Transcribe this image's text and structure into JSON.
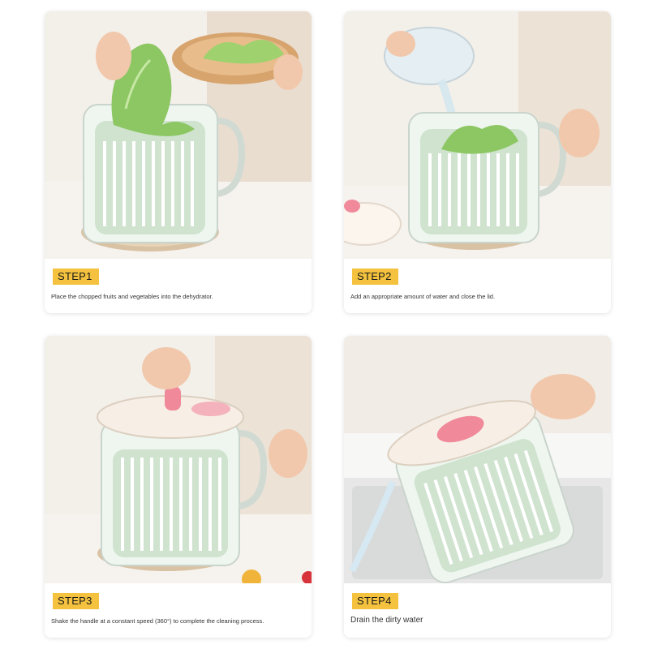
{
  "steps": [
    {
      "label": "STEP1",
      "text": "Place the chopped fruits and vegetables into the dehydrator."
    },
    {
      "label": "STEP2",
      "text": "Add an appropriate amount of water and close the lid."
    },
    {
      "label": "STEP3",
      "text": "Shake the handle at a constant speed (360°) to complete the cleaning process."
    },
    {
      "label": "STEP4",
      "text": "Drain the dirty water"
    }
  ],
  "colors": {
    "step_tag": "#f4c23e",
    "basket_green": "#cfe3cf",
    "lid_pink": "#f08a9a",
    "lettuce": "#8cc763"
  }
}
